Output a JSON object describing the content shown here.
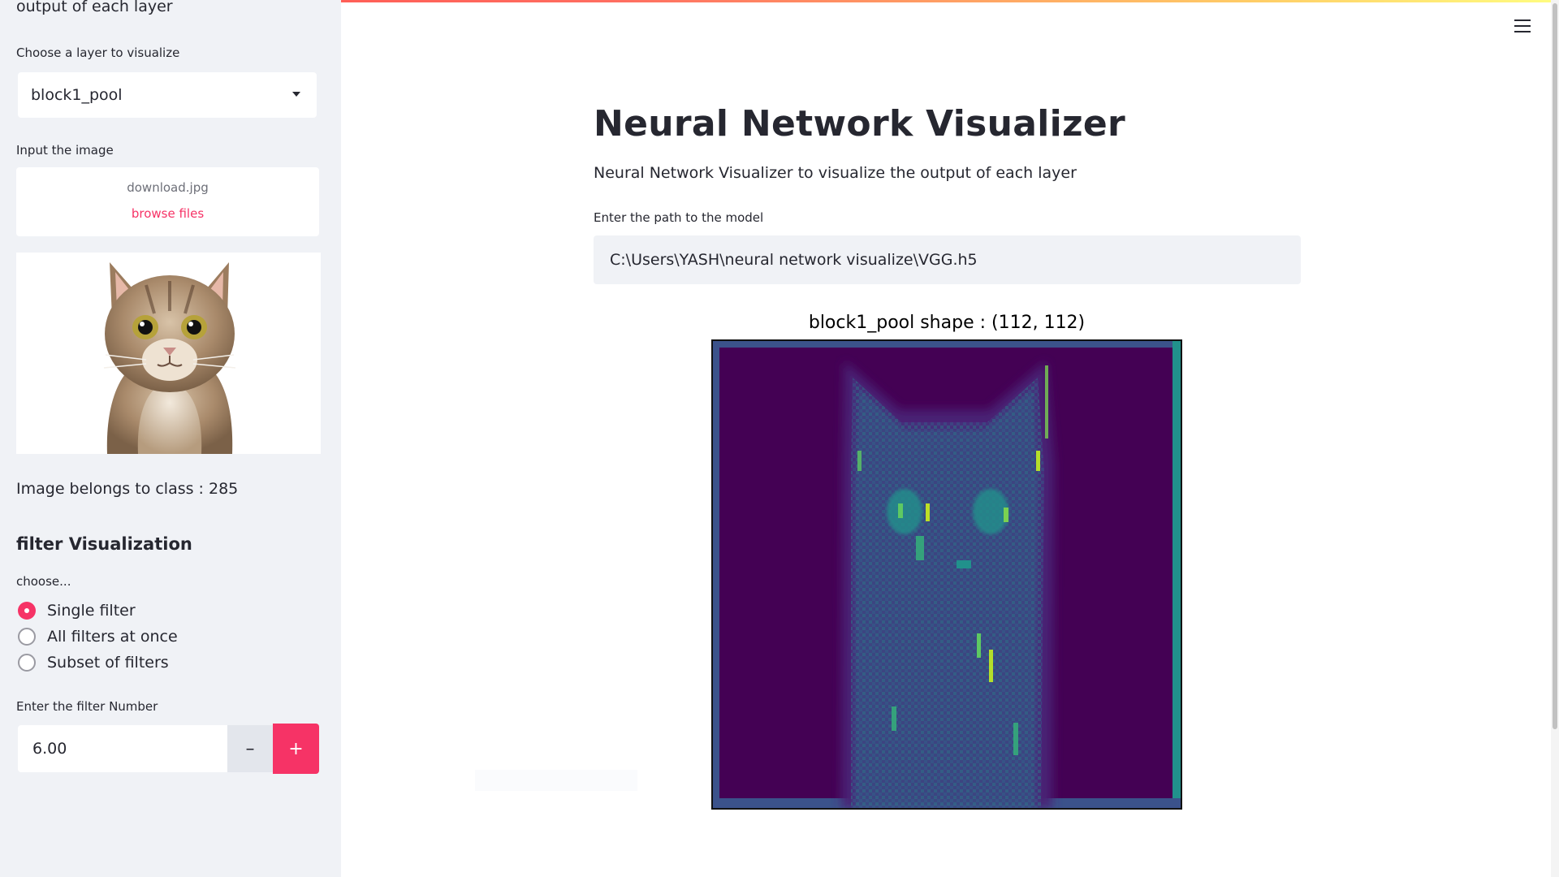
{
  "sidebar": {
    "top_text": "output of each layer",
    "layer_label": "Choose a layer to visualize",
    "layer_selected": "block1_pool",
    "input_label": "Input the image",
    "file_name": "download.jpg",
    "browse_label": "browse files",
    "class_text": "Image belongs to class : 285",
    "filter_heading": "filter Visualization",
    "choose_label": "choose...",
    "radio_options": [
      {
        "label": "Single filter",
        "selected": true
      },
      {
        "label": "All filters at once",
        "selected": false
      },
      {
        "label": "Subset of filters",
        "selected": false
      }
    ],
    "filter_number_label": "Enter the filter Number",
    "filter_number_value": "6.00",
    "minus_label": "–",
    "plus_label": "+"
  },
  "main": {
    "title": "Neural Network Visualizer",
    "subtitle": "Neural Network Visualizer to visualize the output of each layer",
    "path_label": "Enter the path to the model",
    "path_value": "C:\\Users\\YASH\\neural network visualize\\VGG.h5",
    "figure_title": "block1_pool shape : (112, 112)"
  },
  "colors": {
    "accent": "#f63366",
    "sidebar_bg": "#f0f2f6",
    "viridis_dark": "#440154",
    "viridis_mid": "#21918c",
    "viridis_bright": "#fde725"
  },
  "icons": {
    "menu": "hamburger-menu-icon",
    "dropdown": "caret-down-icon"
  }
}
